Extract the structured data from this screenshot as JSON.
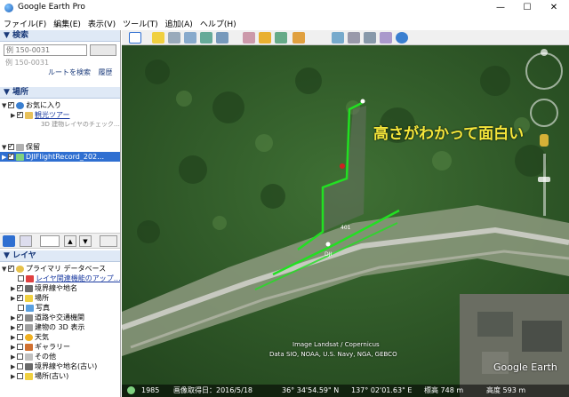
{
  "window": {
    "title": "Google Earth Pro",
    "minimize": "—",
    "maximize": "☐",
    "close": "✕"
  },
  "menu": [
    "ファイル(F)",
    "編集(E)",
    "表示(V)",
    "ツール(T)",
    "追加(A)",
    "ヘルプ(H)"
  ],
  "search": {
    "header": "▼ 検索",
    "placeholder": "例 150-0031",
    "route_link": "ルートを検索",
    "history_link": "履歴"
  },
  "places": {
    "header": "▼ 場所",
    "items": [
      {
        "label": "お気に入り",
        "checked": true
      },
      {
        "label": "観光ツアー",
        "checked": true
      },
      {
        "label": "3D 建物レイヤのチェック…",
        "checked": false
      },
      {
        "label": "保留",
        "checked": true
      },
      {
        "label": "DJIFlightRecord_202…",
        "checked": true
      }
    ]
  },
  "layers": {
    "header": "▼ レイヤ",
    "items": [
      {
        "label": "プライマリ データベース",
        "checked": true
      },
      {
        "label": "レイヤ関連機能のアップ…",
        "checked": false
      },
      {
        "label": "境界線や地名",
        "checked": true
      },
      {
        "label": "場所",
        "checked": true
      },
      {
        "label": "写真",
        "checked": false
      },
      {
        "label": "道路や交通機関",
        "checked": true
      },
      {
        "label": "建物の 3D 表示",
        "checked": true
      },
      {
        "label": "天気",
        "checked": false
      },
      {
        "label": "ギャラリー",
        "checked": false
      },
      {
        "label": "その他",
        "checked": false
      },
      {
        "label": "境界線や地名(古い)",
        "checked": false
      },
      {
        "label": "場所(古い)",
        "checked": false
      }
    ]
  },
  "map": {
    "annotation": "高さがわかって面白い",
    "label_1": "401",
    "label_2": "DJI",
    "imagery_credit_1": "Image Landsat / Copernicus",
    "imagery_credit_2": "Data SIO, NOAA, U.S. Navy, NGA, GEBCO",
    "logo": "Google Earth",
    "scale_year": "1985"
  },
  "status": {
    "date": "画像取得日：2016/5/18",
    "lat": "36° 34'54.59\" N",
    "lon": "137° 02'01.63\" E",
    "elev": "標高  748 m",
    "eye": "高度  593 m"
  },
  "colors": {
    "track": "#22e022",
    "annotation": "#f5e63a",
    "panel_header": "#dfe9f6"
  }
}
